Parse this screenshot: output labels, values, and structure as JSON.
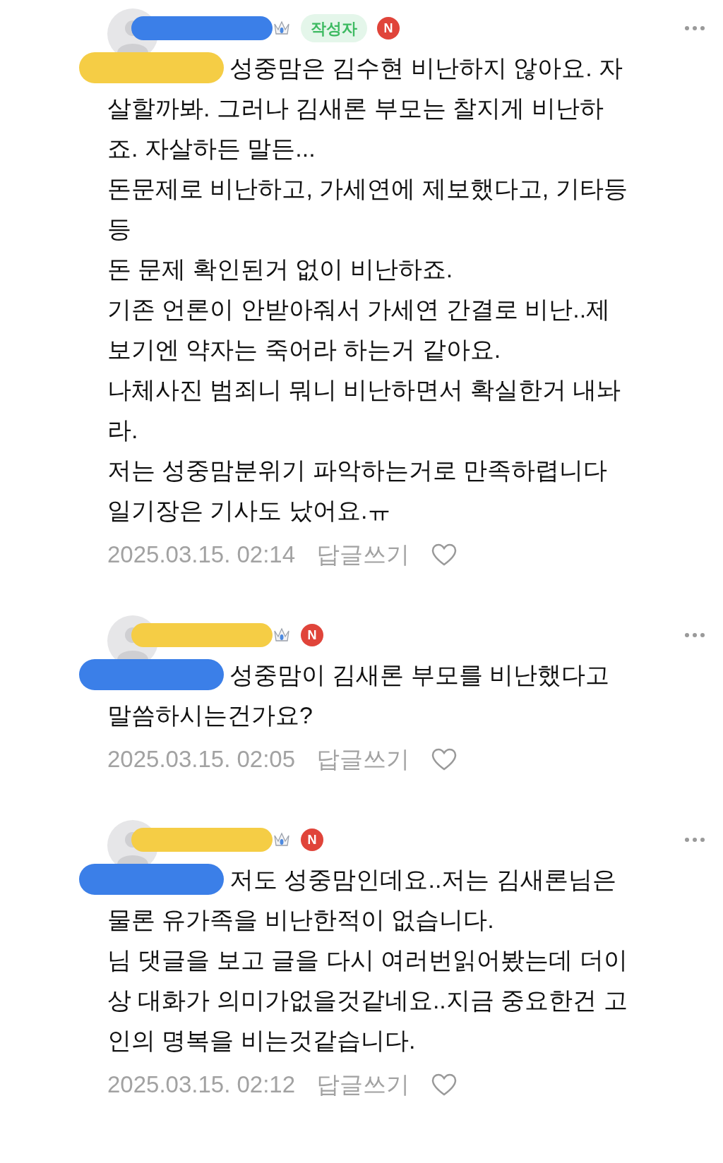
{
  "comments": [
    {
      "author_mark": {
        "color": "#3b7fe8"
      },
      "author_badge": "작성자",
      "new_badge": "N",
      "mention_mark": {
        "color": "#f5cd45"
      },
      "paragraphs": [
        "성중맘은 김수현 비난하지 않아요. 자살할까봐. 그러나 김새론 부모는 찰지게 비난하죠. 자살하든 말든...",
        "돈문제로 비난하고, 가세연에 제보했다고, 기타등등",
        "돈 문제 확인된거 없이 비난하죠.",
        "기존 언론이 안받아줘서 가세연 간결로 비난..제보기엔 약자는 죽어라 하는거 같아요.",
        "나체사진 범죄니 뭐니 비난하면서 확실한거 내놔라.",
        "저는 성중맘분위기 파악하는거로 만족하렵니다",
        "일기장은 기사도 났어요.ㅠ"
      ],
      "date": "2025.03.15. 02:14",
      "reply": "답글쓰기"
    },
    {
      "author_mark": {
        "color": "#f5cd45"
      },
      "new_badge": "N",
      "mention_mark": {
        "color": "#3b7fe8"
      },
      "paragraphs": [
        "성중맘이 김새론 부모를 비난했다고 말씀하시는건가요?"
      ],
      "date": "2025.03.15. 02:05",
      "reply": "답글쓰기"
    },
    {
      "author_mark": {
        "color": "#f5cd45"
      },
      "new_badge": "N",
      "mention_mark": {
        "color": "#3b7fe8"
      },
      "paragraphs": [
        "저도 성중맘인데요..저는 김새론님은 물론 유가족을 비난한적이 없습니다.",
        "님 댓글을 보고 글을 다시 여러번읽어봤는데 더이상 대화가 의미가없을것같네요..지금 중요한건 고인의 명복을 비는것같습니다."
      ],
      "date": "2025.03.15. 02:12",
      "reply": "답글쓰기"
    }
  ]
}
